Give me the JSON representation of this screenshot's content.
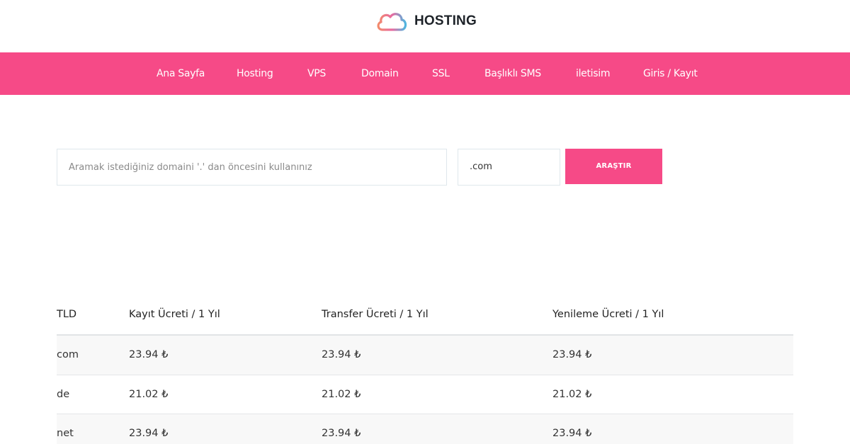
{
  "brand": {
    "name": "HOSTING",
    "icon": "cloud-logo-icon"
  },
  "nav": {
    "items": [
      {
        "label": "Ana Sayfa"
      },
      {
        "label": "Hosting"
      },
      {
        "label": "VPS"
      },
      {
        "label": "Domain"
      },
      {
        "label": "SSL"
      },
      {
        "label": "Başlıklı SMS"
      },
      {
        "label": "iletisim"
      },
      {
        "label": "Giris / Kayıt"
      }
    ]
  },
  "search": {
    "placeholder": "Aramak istediğiniz domaini '.' dan öncesini kullanınız",
    "value": "",
    "tld_selected": ".com",
    "button_label": "ARAŞTIR"
  },
  "pricing_table": {
    "headers": [
      "TLD",
      "Kayıt Ücreti / 1 Yıl",
      "Transfer Ücreti / 1 Yıl",
      "Yenileme Ücreti / 1 Yıl"
    ],
    "rows": [
      [
        "com",
        "23.94 ₺",
        "23.94 ₺",
        "23.94 ₺"
      ],
      [
        "de",
        "21.02 ₺",
        "21.02 ₺",
        "21.02 ₺"
      ],
      [
        "net",
        "23.94 ₺",
        "23.94 ₺",
        "23.94 ₺"
      ]
    ]
  },
  "colors": {
    "accent": "#f64a87",
    "logo_gradient_start": "#f28a6b",
    "logo_gradient_end": "#4fb6e0"
  }
}
